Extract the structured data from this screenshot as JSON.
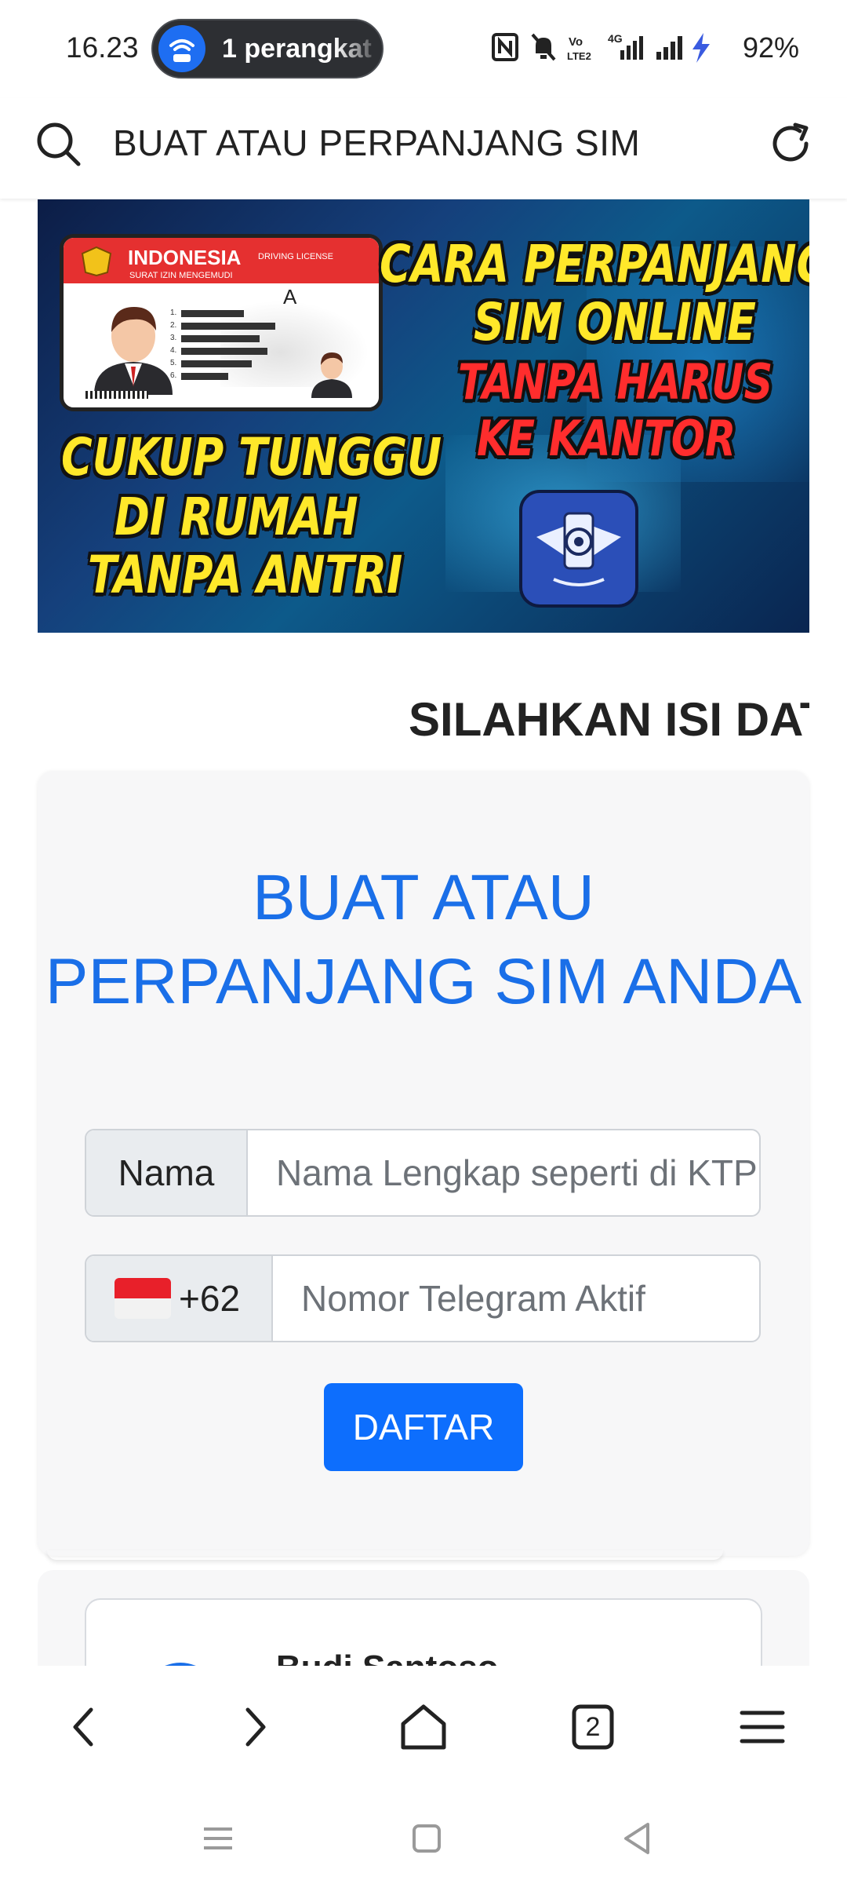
{
  "status_bar": {
    "time": "16.23",
    "hotspot_text": "1 perangkat",
    "battery": "92%",
    "icons": [
      "nfc-icon",
      "mute-icon",
      "volte-icon",
      "4g-signal-icon",
      "signal-icon",
      "charging-icon"
    ]
  },
  "address_bar": {
    "title": "BUAT ATAU PERPANJANG SIM",
    "icons": [
      "search-icon",
      "reload-icon"
    ]
  },
  "banner": {
    "license_country": "INDONESIA",
    "license_type": "DRIVING LICENSE",
    "license_subtitle": "SURAT IZIN MENGEMUDI",
    "license_class": "A",
    "headline_line1": "CARA PERPANJANGAN",
    "headline_line2": "SIM ONLINE",
    "headline_line3": "TANPA HARUS",
    "headline_line4": "KE KANTOR",
    "left_line1": "CUKUP TUNGGU",
    "left_line2": "DI RUMAH",
    "left_line3": "TANPA ANTRI",
    "license_row_numbers": [
      "1.",
      "2.",
      "3.",
      "4.",
      "5.",
      "6."
    ]
  },
  "marquee_text": "SILAHKAN ISI DATA",
  "form": {
    "title": "BUAT ATAU PERPANJANG SIM ANDA",
    "name_label": "Nama",
    "name_placeholder": "Nama Lengkap seperti di KTP",
    "phone_code": "+62",
    "phone_placeholder": "Nomor Telegram Aktif",
    "submit_label": "DAFTAR"
  },
  "testimonial": {
    "name": "Budi Santoso"
  },
  "bottom_nav": {
    "tab_count": "2",
    "icons": [
      "back-icon",
      "forward-icon",
      "home-icon",
      "tabs-icon",
      "menu-icon"
    ]
  },
  "system_nav": {
    "icons": [
      "recent-apps-icon",
      "home-square-icon",
      "back-triangle-icon"
    ]
  },
  "colors": {
    "accent_blue": "#1a6fe8",
    "button_blue": "#0d6efd",
    "flag_red": "#e8202a"
  }
}
